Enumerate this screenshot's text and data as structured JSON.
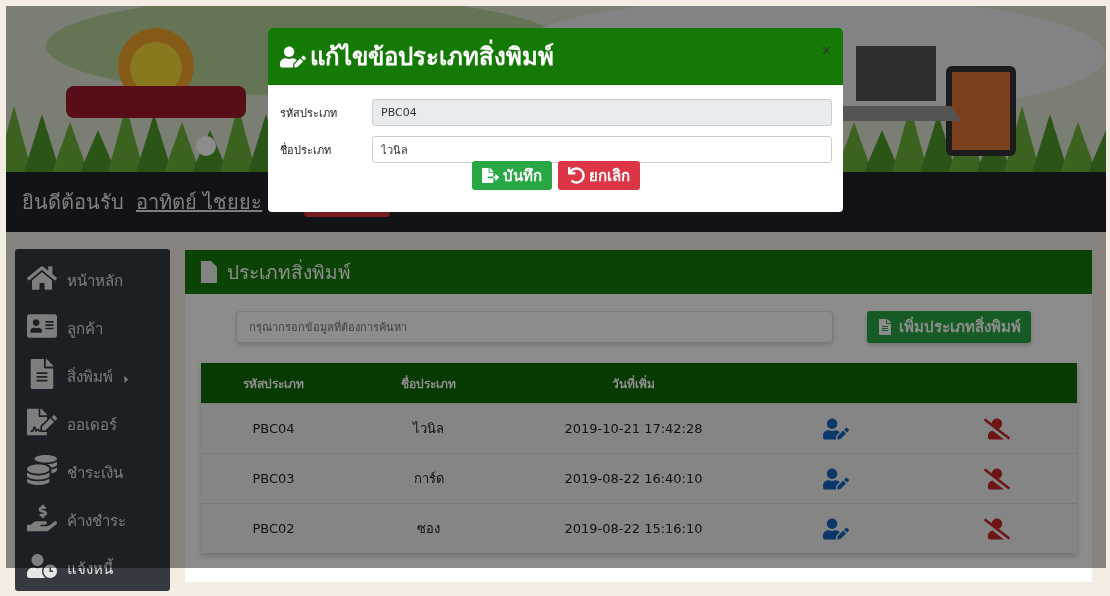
{
  "nav": {
    "greeting": "ยินดีต้อนรับ",
    "user_link": "อาทิตย์ ไชยยะ"
  },
  "sidebar": {
    "items": [
      {
        "label": "หน้าหลัก",
        "expandable": false
      },
      {
        "label": "ลูกค้า",
        "expandable": false
      },
      {
        "label": "สิ่งพิมพ์",
        "expandable": true
      },
      {
        "label": "ออเดอร์",
        "expandable": false
      },
      {
        "label": "ชำระเงิน",
        "expandable": false
      },
      {
        "label": "ค้างชำระ",
        "expandable": false
      },
      {
        "label": "แจ้งหนี้",
        "expandable": false
      }
    ]
  },
  "panel": {
    "title": "ประเภทสิ่งพิมพ์",
    "search": {
      "placeholder": "กรุณากรอกข้อมูลที่ต้องการค้นหา"
    },
    "add_button": "เพิ่มประเภทสิ่งพิมพ์",
    "table": {
      "columns": [
        "รหัสประเภท",
        "ชื่อประเภท",
        "วันที่เพิ่ม"
      ],
      "rows": [
        {
          "code": "PBC04",
          "name": "ไวนิล",
          "added": "2019-10-21 17:42:28"
        },
        {
          "code": "PBC03",
          "name": "การ์ด",
          "added": "2019-08-22 16:40:10"
        },
        {
          "code": "PBC02",
          "name": "ซอง",
          "added": "2019-08-22 15:16:10"
        }
      ]
    }
  },
  "modal": {
    "title": "แก้ไขข้อประเภทสิ่งพิมพ์",
    "close": "×",
    "fields": [
      {
        "label": "รหัสประเภท",
        "value": "PBC04",
        "disabled": true
      },
      {
        "label": "ชื่อประเภท",
        "value": "ไวนิล",
        "disabled": false
      }
    ],
    "buttons": [
      {
        "label": "บันทึก",
        "kind": "save"
      },
      {
        "label": "ยกเลิก",
        "kind": "cancel"
      }
    ]
  }
}
